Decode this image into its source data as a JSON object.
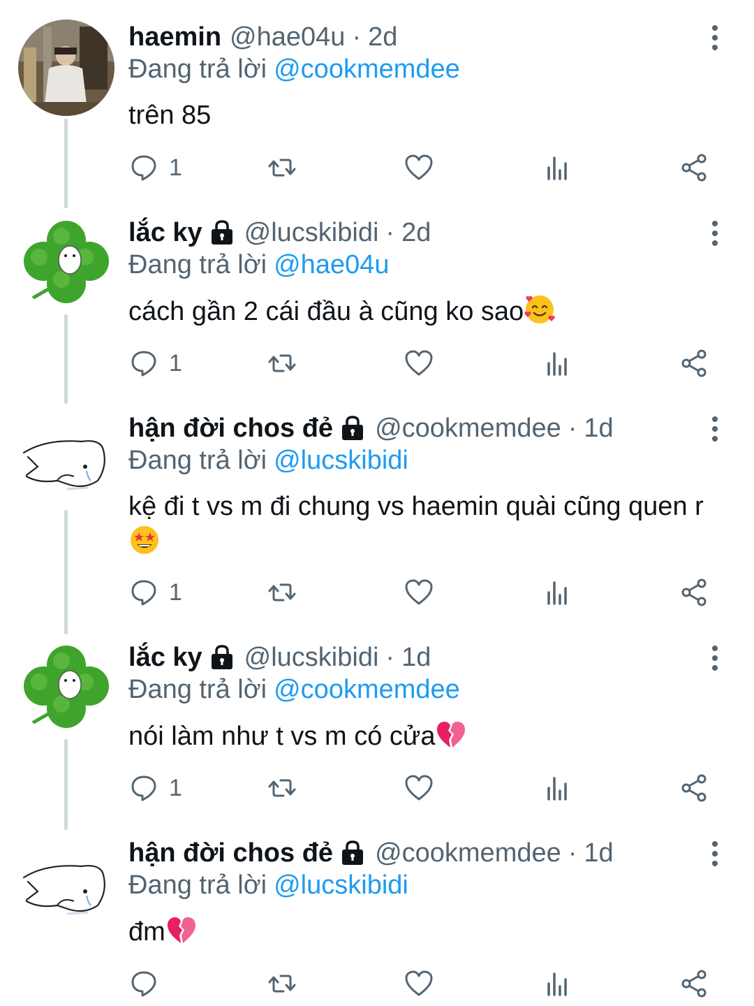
{
  "tweets": [
    {
      "name": "haemin",
      "locked": false,
      "handle": "@hae04u",
      "dot": "·",
      "time": "2d",
      "reply_prefix": "Đang trả lời",
      "reply_to": "@cookmemdee",
      "text": "trên 85",
      "emoji": "",
      "reply_count": "1",
      "avatar_icon": "photo-avatar-icon"
    },
    {
      "name": "lắc ky",
      "locked": true,
      "handle": "@lucskibidi",
      "dot": "·",
      "time": "2d",
      "reply_prefix": "Đang trả lời",
      "reply_to": "@hae04u",
      "text": "cách gần 2 cái đầu à cũng ko sao",
      "emoji": "smiling-face-with-hearts-emoji",
      "reply_count": "1",
      "avatar_icon": "clover-avatar-icon"
    },
    {
      "name": "hận đời chos đẻ",
      "locked": true,
      "handle": "@cookmemdee",
      "dot": "·",
      "time": "1d",
      "reply_prefix": "Đang trả lời",
      "reply_to": "@lucskibidi",
      "text": "kệ đi t vs m đi chung vs haemin quài cũng quen r",
      "emoji": "star-struck-emoji",
      "reply_count": "1",
      "avatar_icon": "sketch-avatar-icon"
    },
    {
      "name": "lắc ky",
      "locked": true,
      "handle": "@lucskibidi",
      "dot": "·",
      "time": "1d",
      "reply_prefix": "Đang trả lời",
      "reply_to": "@cookmemdee",
      "text": "nói làm như t vs m có cửa",
      "emoji": "broken-heart-emoji",
      "reply_count": "1",
      "avatar_icon": "clover-avatar-icon"
    },
    {
      "name": "hận đời chos đẻ",
      "locked": true,
      "handle": "@cookmemdee",
      "dot": "·",
      "time": "1d",
      "reply_prefix": "Đang trả lời",
      "reply_to": "@lucskibidi",
      "text": "đm",
      "emoji": "broken-heart-emoji",
      "reply_count": "",
      "avatar_icon": "sketch-avatar-icon"
    }
  ],
  "action_icons": [
    "reply-icon",
    "retweet-icon",
    "like-icon",
    "views-icon",
    "share-icon"
  ],
  "colors": {
    "text": "#0f1419",
    "secondary": "#536471",
    "mention": "#1d9bf0",
    "thread_line": "#cfd9de"
  }
}
